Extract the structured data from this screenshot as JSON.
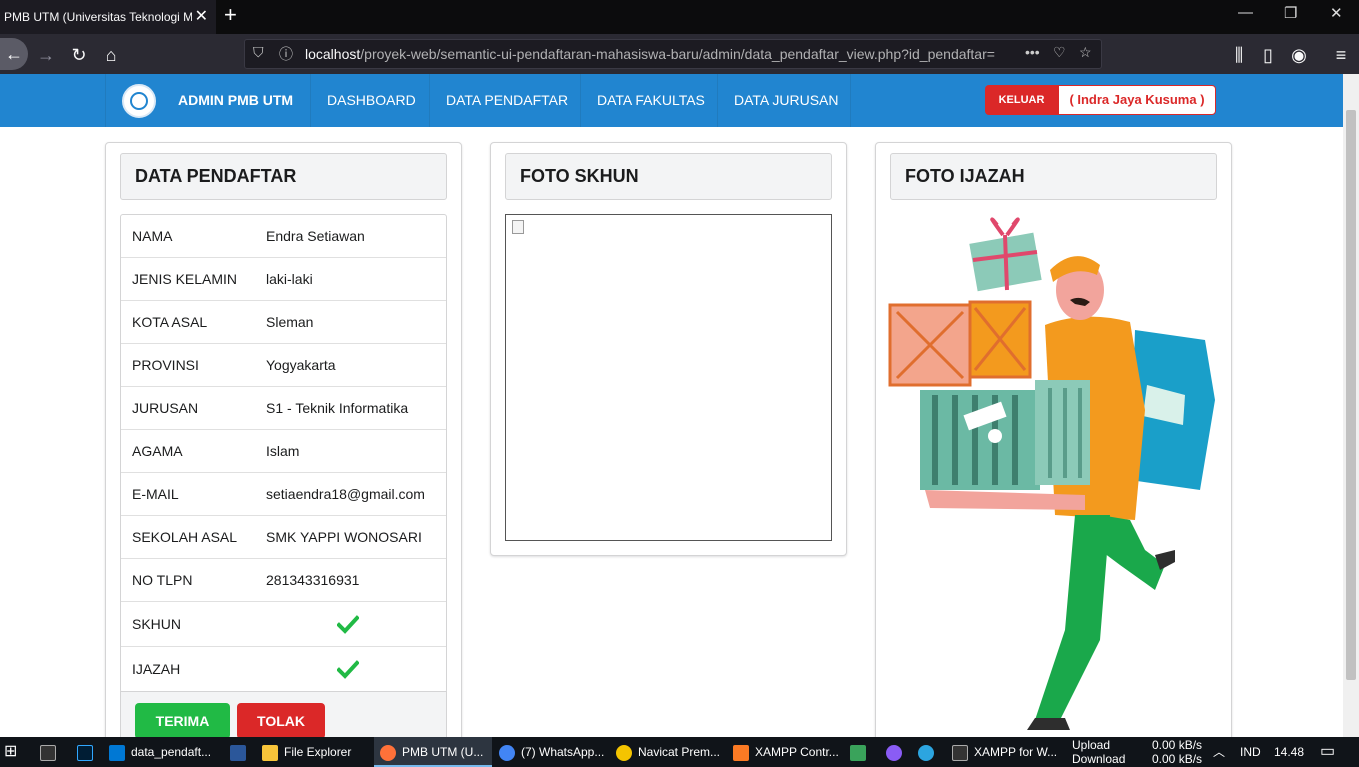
{
  "browser": {
    "tab_title": "PMB UTM (Universitas Teknologi M",
    "url_host": "localhost",
    "url_path": "/proyek-web/semantic-ui-pendaftaran-mahasiswa-baru/admin/data_pendaftar_view.php?id_pendaftar="
  },
  "nav": {
    "brand": "ADMIN PMB UTM",
    "items": [
      "DASHBOARD",
      "DATA PENDAFTAR",
      "DATA FAKULTAS",
      "DATA JURUSAN"
    ],
    "logout_label": "KELUAR",
    "user_label": "( Indra Jaya Kusuma )"
  },
  "panel_data": {
    "title": "DATA PENDAFTAR",
    "rows": [
      {
        "label": "NAMA",
        "value": "Endra Setiawan"
      },
      {
        "label": "JENIS KELAMIN",
        "value": "laki-laki"
      },
      {
        "label": "KOTA ASAL",
        "value": "Sleman"
      },
      {
        "label": "PROVINSI",
        "value": "Yogyakarta"
      },
      {
        "label": "JURUSAN",
        "value": "S1 - Teknik Informatika"
      },
      {
        "label": "AGAMA",
        "value": "Islam"
      },
      {
        "label": "E-MAIL",
        "value": "setiaendra18@gmail.com"
      },
      {
        "label": "SEKOLAH ASAL",
        "value": "SMK YAPPI WONOSARI"
      },
      {
        "label": "NO TLPN",
        "value": "281343316931"
      },
      {
        "label": "SKHUN",
        "check_icon": "check-icon"
      },
      {
        "label": "IJAZAH",
        "check_icon": "check-icon"
      }
    ],
    "accept_label": "TERIMA",
    "reject_label": "TOLAK"
  },
  "panel_skhun": {
    "title": "FOTO SKHUN",
    "image": "broken-image-icon"
  },
  "panel_ijazah": {
    "title": "FOTO IJAZAH",
    "image": "delivery-man-illustration"
  },
  "taskbar": {
    "items": [
      "data_pendaft...",
      "File Explorer",
      "PMB UTM (U...",
      "(7) WhatsApp...",
      "Navicat Prem...",
      "XAMPP Contr...",
      "XAMPP for W..."
    ],
    "net_upload_label": "Upload",
    "net_download_label": "Download",
    "net_upload": "0.00 kB/s",
    "net_download": "0.00 kB/s",
    "lang": "IND",
    "time": "14.48"
  },
  "colors": {
    "primary": "#2185d0",
    "red": "#db2828",
    "green": "#21ba45"
  }
}
